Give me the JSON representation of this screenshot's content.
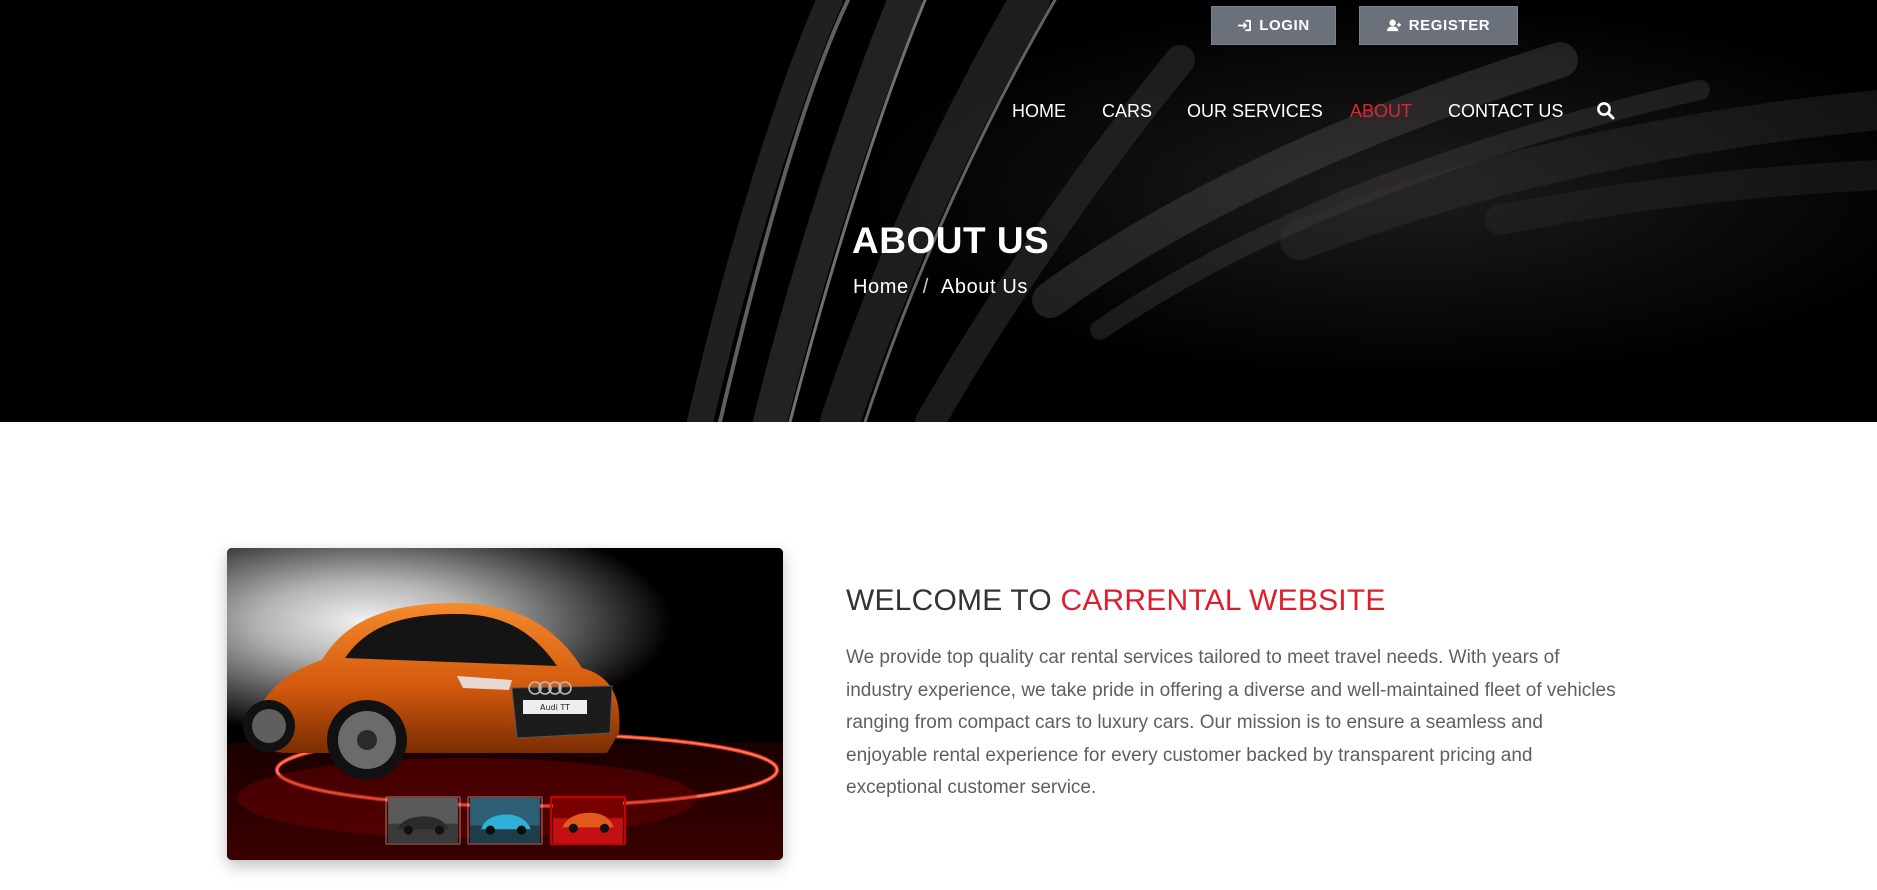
{
  "header": {
    "login_label": "LOGIN",
    "register_label": "REGISTER",
    "nav": {
      "home": "HOME",
      "cars": "CARS",
      "services": "OUR SERVICES",
      "about": "ABOUT",
      "contact": "CONTACT US",
      "active": "ABOUT",
      "search_icon": "search-icon"
    }
  },
  "hero": {
    "title": "ABOUT US",
    "breadcrumb": {
      "home": "Home",
      "separator": "/",
      "current": "About Us"
    }
  },
  "about": {
    "heading_prefix": "WELCOME TO ",
    "heading_accent": "CARRENTAL WEBSITE",
    "body": "We provide top quality car rental services tailored to meet travel needs. With years of industry experience, we take pride in offering a diverse and well-maintained fleet of vehicles ranging from compact cars to luxury cars. Our mission is to ensure a seamless and enjoyable rental experience for every customer backed by transparent pricing and exceptional customer service.",
    "car_plate": "Audi TT",
    "thumbnail_count": 3
  },
  "colors": {
    "accent": "#e11d2b",
    "nav_active": "#e02530",
    "button_bg": "#6b717a",
    "hero_bg": "#000000",
    "body_text": "#5f5f5f",
    "heading_text": "#333333"
  }
}
